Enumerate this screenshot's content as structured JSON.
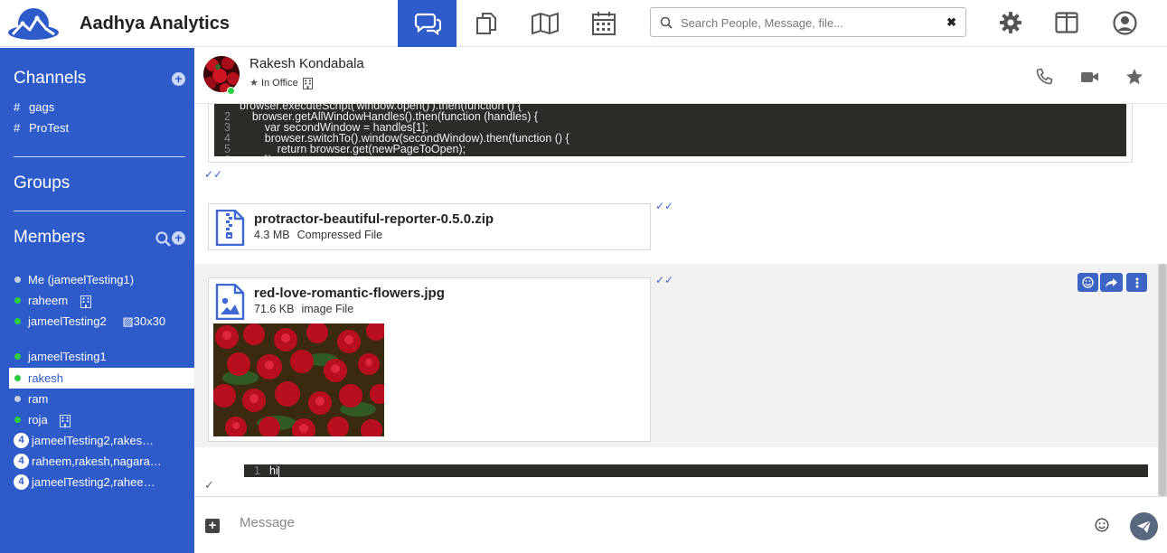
{
  "app": {
    "title": "Aadhya Analytics"
  },
  "topbar": {
    "nav": [
      {
        "name": "chat-nav",
        "icon": "chat-bubbles-icon",
        "active": true
      },
      {
        "name": "files-nav",
        "icon": "copy-files-icon",
        "active": false
      },
      {
        "name": "map-nav",
        "icon": "map-icon",
        "active": false
      },
      {
        "name": "calendar-nav",
        "icon": "calendar-icon",
        "active": false
      }
    ],
    "search": {
      "placeholder": "Search People, Message, file...",
      "value": "",
      "clear_label": "✖"
    },
    "right_icons": [
      "gear-icon",
      "split-view-icon",
      "user-account-icon"
    ]
  },
  "sidebar": {
    "channels_title": "Channels",
    "channels": [
      {
        "hash": "#",
        "label": "gags"
      },
      {
        "hash": "#",
        "label": "ProTest"
      }
    ],
    "groups_title": "Groups",
    "members_title": "Members",
    "members": [
      {
        "label": "Me (jameelTesting1)",
        "status": "offline"
      },
      {
        "label": "raheem",
        "status": "online",
        "badge": "building-icon"
      },
      {
        "label": "jameelTesting2",
        "status": "online",
        "img_alt": "30x30"
      },
      {
        "label": "jameelTesting1",
        "status": "online"
      },
      {
        "label": "rakesh",
        "status": "online",
        "active": true
      },
      {
        "label": "ram",
        "status": "offline"
      },
      {
        "label": "roja",
        "status": "online",
        "badge": "building-icon"
      },
      {
        "label": "jameelTesting2,rakes…",
        "count": "4"
      },
      {
        "label": "raheem,rakesh,nagara…",
        "count": "4"
      },
      {
        "label": "jameelTesting2,rahee…",
        "count": "4"
      }
    ],
    "colors": {
      "online": "#2ecc40",
      "offline": "#c8d0e0",
      "accent": "#2d5bc9"
    }
  },
  "chat": {
    "contact_name": "Rakesh Kondabala",
    "contact_status": "In Office",
    "header_actions": [
      "phone-icon",
      "video-camera-icon",
      "star-icon"
    ],
    "code_message": {
      "lines": [
        {
          "n": "",
          "text": "browser.executeScript('window.open()').then(function () {"
        },
        {
          "n": "2",
          "text": "    browser.getAllWindowHandles().then(function (handles) {"
        },
        {
          "n": "3",
          "text": "        var secondWindow = handles[1];"
        },
        {
          "n": "4",
          "text": "        browser.switchTo().window(secondWindow).then(function () {"
        },
        {
          "n": "5",
          "text": "            return browser.get(newPageToOpen);"
        },
        {
          "n": "6",
          "text": "        });"
        }
      ],
      "ticks": "✓✓"
    },
    "file_message": {
      "name": "protractor-beautiful-reporter-0.5.0.zip",
      "size": "4.3 MB",
      "type": "Compressed File",
      "ticks": "✓✓"
    },
    "image_message": {
      "name": "red-love-romantic-flowers.jpg",
      "size": "71.6 KB",
      "type": "image File",
      "ticks": "✓✓"
    },
    "hover_actions": [
      "smiley-icon",
      "share-icon",
      "more-vertical-icon"
    ],
    "last_code": {
      "n": "1",
      "text": "hi"
    },
    "last_tick": "✓"
  },
  "composer": {
    "placeholder": "Message",
    "value": ""
  }
}
